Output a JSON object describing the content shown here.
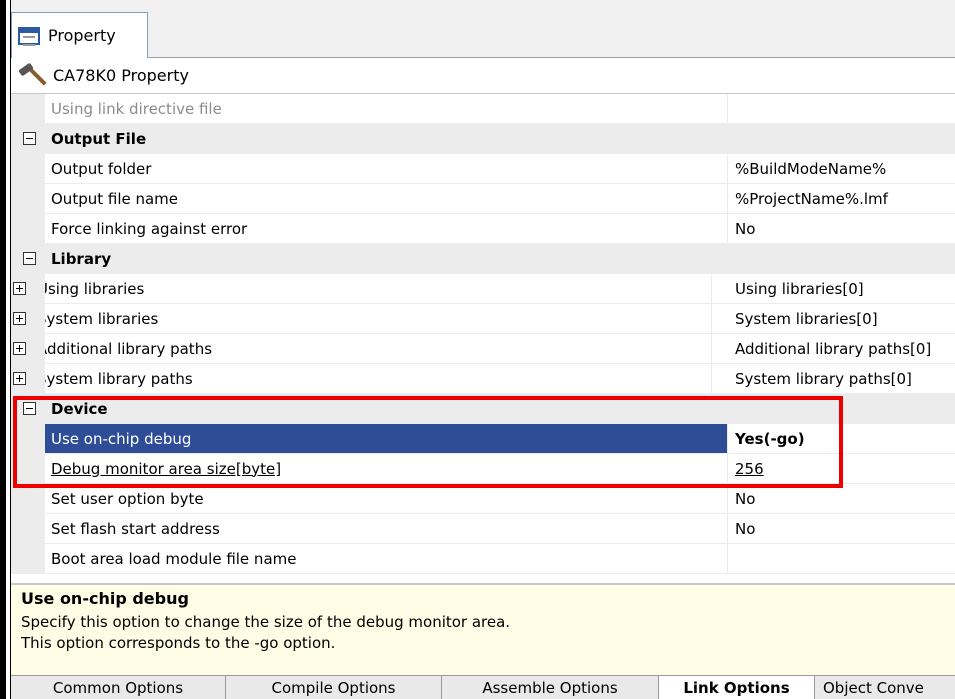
{
  "doc_tab": {
    "label": "Property",
    "icon": "property-window-icon"
  },
  "header": {
    "title": "CA78K0 Property",
    "icon": "hammer-icon"
  },
  "rows": [
    {
      "name": "Using link directive file",
      "value": ""
    },
    {
      "category": "Output File"
    },
    {
      "name": "Output folder",
      "value": "%BuildModeName%"
    },
    {
      "name": "Output file name",
      "value": "%ProjectName%.lmf"
    },
    {
      "name": "Force linking against error",
      "value": "No"
    },
    {
      "category": "Library"
    },
    {
      "name": "Using libraries",
      "value": "Using libraries[0]"
    },
    {
      "name": "System libraries",
      "value": "System libraries[0]"
    },
    {
      "name": "Additional library paths",
      "value": "Additional library paths[0]"
    },
    {
      "name": "System library paths",
      "value": "System library paths[0]"
    },
    {
      "category": "Device"
    },
    {
      "name": "Use on-chip debug",
      "value": "Yes(-go)"
    },
    {
      "name": "Debug monitor area size[byte]",
      "value": "256"
    },
    {
      "name": "Set user option byte",
      "value": "No"
    },
    {
      "name": "Set flash start address",
      "value": "No"
    },
    {
      "name": "Boot area load module file name",
      "value": ""
    }
  ],
  "description": {
    "title": "Use on-chip debug",
    "line1": "Specify this option to change the size of the debug monitor area.",
    "line2": "This option corresponds to the -go option."
  },
  "bottom_tabs": [
    "Common Options",
    "Compile Options",
    "Assemble Options",
    "Link Options",
    "Object Conve"
  ],
  "active_tab": "Link Options",
  "colors": {
    "selection": "#2f4d97",
    "highlight": "#ee0000",
    "description_bg": "#fffde6"
  }
}
